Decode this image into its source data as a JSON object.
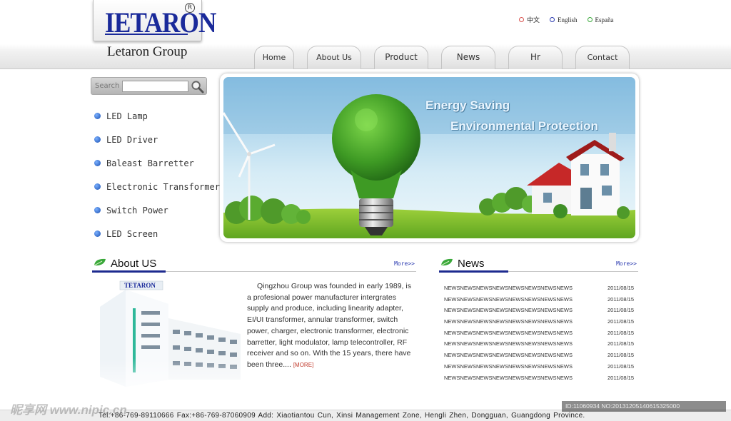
{
  "brand": {
    "logo_text": "IETARON",
    "reg_mark": "R",
    "group_name": "Letaron Group"
  },
  "languages": [
    {
      "label": "中文",
      "color": "#d9534f"
    },
    {
      "label": "English",
      "color": "#2a3ab0"
    },
    {
      "label": "España",
      "color": "#3aa83a"
    }
  ],
  "nav": [
    "Home",
    "About Us",
    "Product",
    "News",
    "Hr",
    "Contact"
  ],
  "search": {
    "label": "Search",
    "placeholder": ""
  },
  "menu": [
    "LED Lamp",
    "LED Driver",
    "Baleast Barretter",
    "Electronic Transformer",
    "Switch Power",
    "LED Screen"
  ],
  "banner": {
    "line1": "Energy Saving",
    "line2": "Environmental Protection"
  },
  "about": {
    "title": "About US",
    "more": "More>>",
    "text": "Qingzhou Group was founded in early 1989, is a profesional power manufacturer intergrates supply and produce, including linearity adapter,  EI/UI transformer, annular transformer, switch power, charger, electronic transformer, electronic barretter, light modulator, lamp telecontroller, RF receiver and so on. With the 15 years, there have been three....",
    "more_tag": "[MORE]",
    "building_sign": "TETARON"
  },
  "news": {
    "title": "News",
    "more": "More>>",
    "items": [
      {
        "title": "NEWSNEWSNEWSNEWSNEWSNEWSNEWSNEWS",
        "date": "2011/08/15"
      },
      {
        "title": "NEWSNEWSNEWSNEWSNEWSNEWSNEWSNEWS",
        "date": "2011/08/15"
      },
      {
        "title": "NEWSNEWSNEWSNEWSNEWSNEWSNEWSNEWS",
        "date": "2011/08/15"
      },
      {
        "title": "NEWSNEWSNEWSNEWSNEWSNEWSNEWSNEWS",
        "date": "2011/08/15"
      },
      {
        "title": "NEWSNEWSNEWSNEWSNEWSNEWSNEWSNEWS",
        "date": "2011/08/15"
      },
      {
        "title": "NEWSNEWSNEWSNEWSNEWSNEWSNEWSNEWS",
        "date": "2011/08/15"
      },
      {
        "title": "NEWSNEWSNEWSNEWSNEWSNEWSNEWSNEWS",
        "date": "2011/08/15"
      },
      {
        "title": "NEWSNEWSNEWSNEWSNEWSNEWSNEWSNEWS",
        "date": "2011/08/15"
      },
      {
        "title": "NEWSNEWSNEWSNEWSNEWSNEWSNEWSNEWS",
        "date": "2011/08/15"
      }
    ]
  },
  "footer": "Tel:+86-769-89110666    Fax:+86-769-87060909    Add: Xiaotiantou Cun, Xinsi Management Zone, Hengli Zhen, Dongguan, Guangdong Province.",
  "watermark": {
    "left": "昵享网 www.nipic.cn",
    "right": "ID:11060934 NO:20131205140615325000"
  },
  "colors": {
    "brand_blue": "#1a2a9a",
    "menu_dot": "#1a4fb0",
    "section_bar": "#1d2a8f",
    "more_red": "#c0392b"
  }
}
